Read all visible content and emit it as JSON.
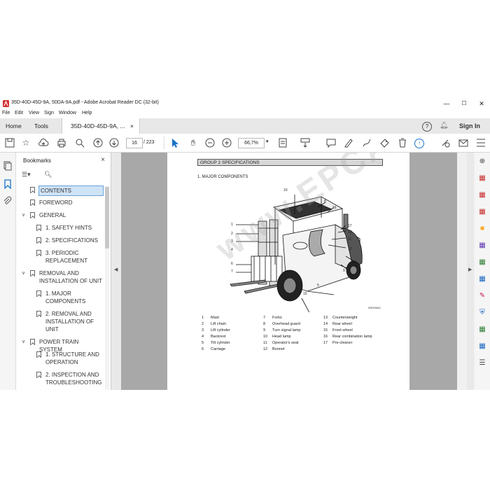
{
  "window": {
    "title": "35D-40D-45D-9A, 50DA-9A.pdf - Adobe Acrobat Reader DC (32-bit)",
    "minimize": "—",
    "maximize": "☐",
    "close": "✕"
  },
  "menu": [
    "File",
    "Edit",
    "View",
    "Sign",
    "Window",
    "Help"
  ],
  "tabs": {
    "home": "Home",
    "tools": "Tools",
    "doc": "35D-40D-45D-9A, ...",
    "doc_close": "×",
    "help": "?",
    "signin": "Sign In"
  },
  "toolbar": {
    "page_current": "16",
    "page_total": "/ 223",
    "zoom": "66,7%"
  },
  "bookmarks": {
    "title": "Bookmarks",
    "close": "×",
    "items": [
      {
        "label": "CONTENTS",
        "level": 0,
        "caret": false,
        "selected": true
      },
      {
        "label": "FOREWORD",
        "level": 0,
        "caret": false
      },
      {
        "label": "GENERAL",
        "level": 0,
        "caret": true
      },
      {
        "label": "1. SAFETY HINTS",
        "level": 1,
        "caret": false
      },
      {
        "label": "2. SPECIFICATIONS",
        "level": 1,
        "caret": false
      },
      {
        "label": "3. PERIODIC REPLACEMENT",
        "level": 1,
        "caret": false
      },
      {
        "label": "REMOVAL AND INSTALLATION OF UNIT",
        "level": 0,
        "caret": true
      },
      {
        "label": "1. MAJOR COMPONENTS",
        "level": 1,
        "caret": false
      },
      {
        "label": "2. REMOVAL AND INSTALLATION OF UNIT",
        "level": 1,
        "caret": false
      },
      {
        "label": "POWER TRAIN SYSTEM",
        "level": 0,
        "caret": true
      },
      {
        "label": "1. STRUCTURE AND OPERATION",
        "level": 1,
        "caret": false
      },
      {
        "label": "2. INSPECTION AND TROUBLESHOOTING",
        "level": 1,
        "caret": false
      }
    ]
  },
  "document": {
    "group_title": "GROUP 2  SPECIFICATIONS",
    "section_title": "1. MAJOR COMPONENTS",
    "figure_code": "50DA9MA1",
    "watermark": "www.EPCATALOG.COM",
    "callouts": [
      "1",
      "2",
      "3",
      "4",
      "5",
      "6",
      "7",
      "8",
      "9",
      "10",
      "11",
      "12",
      "13",
      "14",
      "15",
      "16",
      "17"
    ],
    "legend": [
      [
        {
          "n": "1",
          "t": "Mast"
        },
        {
          "n": "7",
          "t": "Forks"
        },
        {
          "n": "13",
          "t": "Counterweight"
        }
      ],
      [
        {
          "n": "2",
          "t": "Lift chain"
        },
        {
          "n": "8",
          "t": "Overhead guard"
        },
        {
          "n": "14",
          "t": "Rear wheel"
        }
      ],
      [
        {
          "n": "3",
          "t": "Lift cylinder"
        },
        {
          "n": "9",
          "t": "Turn signal lamp"
        },
        {
          "n": "15",
          "t": "Front wheel"
        }
      ],
      [
        {
          "n": "4",
          "t": "Backrest"
        },
        {
          "n": "10",
          "t": "Head lamp"
        },
        {
          "n": "16",
          "t": "Rear combination lamp"
        }
      ],
      [
        {
          "n": "5",
          "t": "Tilt cylinder"
        },
        {
          "n": "11",
          "t": "Operator's seat"
        },
        {
          "n": "17",
          "t": "Pre-cleaner"
        }
      ],
      [
        {
          "n": "6",
          "t": "Carriage"
        },
        {
          "n": "12",
          "t": "Bonnet"
        },
        {
          "n": "",
          "t": ""
        }
      ]
    ]
  }
}
